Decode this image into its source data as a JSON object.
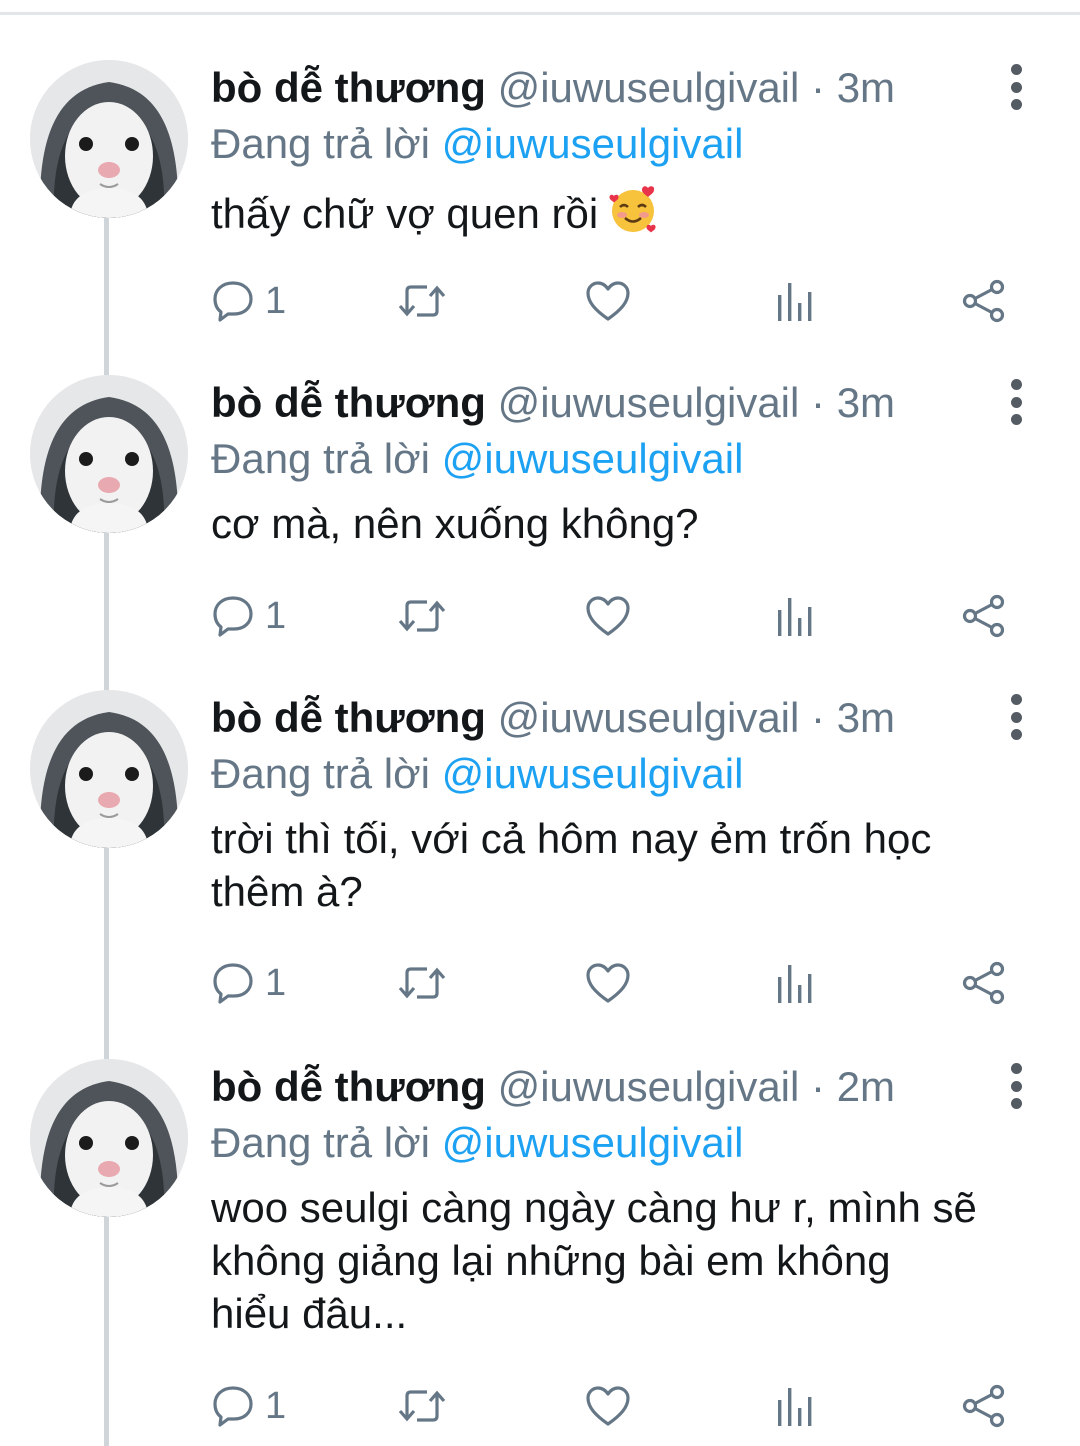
{
  "tweets": [
    {
      "name": "bò dễ thương",
      "handle": "@iuwuseulgivail",
      "separator": "·",
      "time": "3m",
      "reply_prefix": "Đang trả lời",
      "reply_to": "@iuwuseulgivail",
      "text": "thấy chữ vợ quen rồi",
      "emoji": "smiling-face-with-hearts",
      "reply_count": "1"
    },
    {
      "name": "bò dễ thương",
      "handle": "@iuwuseulgivail",
      "separator": "·",
      "time": "3m",
      "reply_prefix": "Đang trả lời",
      "reply_to": "@iuwuseulgivail",
      "text": "cơ mà, nên xuống không?",
      "reply_count": "1"
    },
    {
      "name": "bò dễ thương",
      "handle": "@iuwuseulgivail",
      "separator": "·",
      "time": "3m",
      "reply_prefix": "Đang trả lời",
      "reply_to": "@iuwuseulgivail",
      "text": "trời thì tối, với cả hôm nay ẻm trốn học\nthêm à?",
      "reply_count": "1"
    },
    {
      "name": "bò dễ thương",
      "handle": "@iuwuseulgivail",
      "separator": "·",
      "time": "2m",
      "reply_prefix": "Đang trả lời",
      "reply_to": "@iuwuseulgivail",
      "text": "woo seulgi càng ngày càng hư r, mình sẽ\nkhông giảng lại những bài em không\nhiểu đâu...",
      "reply_count": "1"
    }
  ],
  "colors": {
    "text": "#14171a",
    "secondary": "#657786",
    "link": "#1da1f2",
    "thread_line": "#d0d5da"
  }
}
